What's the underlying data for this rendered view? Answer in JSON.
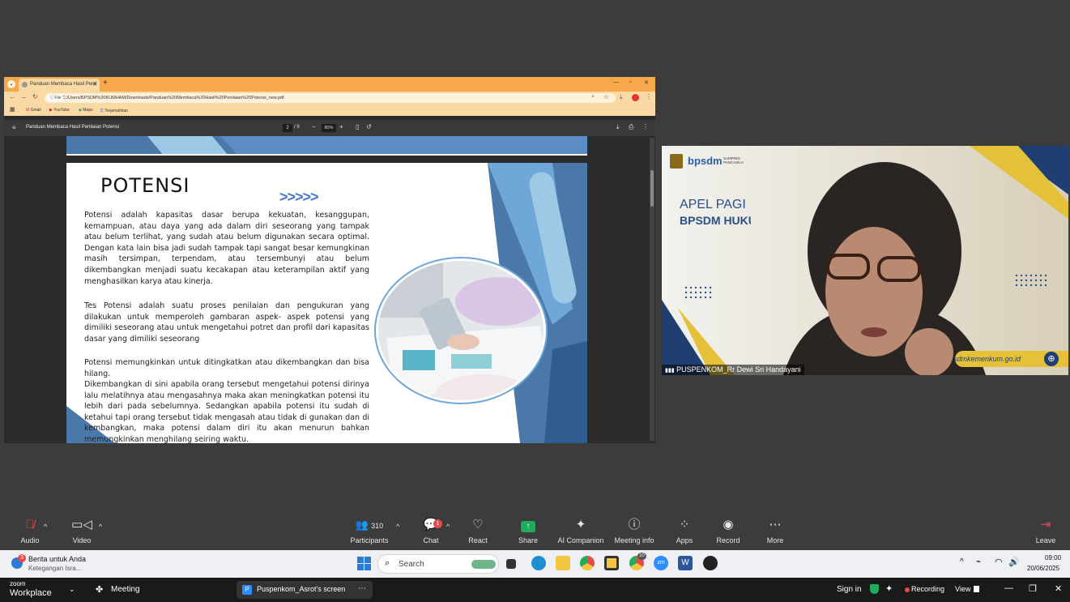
{
  "browser": {
    "tab_title": "Panduan Membaca Hasil Penil",
    "address": "C:/Users/BPSDM%20KUMHAM/Downloads/Panduan%20Membaca%20Hasil%20Penilaian%20Potensi_new.pdf",
    "file_chip": "File",
    "bookmarks": [
      "Gmail",
      "YouTube",
      "Maps",
      "Terjemahkan"
    ]
  },
  "pdf": {
    "title": "Panduan Membaca Hasil Penilaian Potensi",
    "page_current": "2",
    "page_total": "/ 9",
    "zoom": "80%",
    "page": {
      "heading": "POTENSI",
      "chevrons": ">>>>>",
      "para1": "Potensi adalah kapasitas dasar berupa kekuatan, kesanggupan, kemampuan, atau daya yang ada dalam diri seseorang yang tampak atau belum terlihat, yang sudah atau belum digunakan secara optimal. Dengan kata lain bisa jadi sudah tampak tapi sangat besar kemungkinan masih tersimpan, terpendam, atau tersembunyi atau belum dikembangkan menjadi suatu kecakapan atau keterampilan aktif yang menghasilkan karya atau kinerja.",
      "para2": "Tes Potensi adalah suatu proses penilaian dan pengukuran yang dilakukan untuk memperoleh gambaran aspek- aspek potensi yang dimiliki seseorang atau untuk mengetahui potret dan profil dari kapasitas dasar yang dimiliki seseorang",
      "para3": "Potensi memungkinkan untuk ditingkatkan atau dikembangkan dan bisa hilang.",
      "para4": "Dikembangkan di sini apabila orang tersebut  mengetahui potensi dirinya lalu melatihnya atau mengasahnya maka akan meningkatkan  potensi itu lebih dari pada sebelumnya. Sedangkan apabila potensi itu sudah di ketahui tapi orang tersebut tidak mengasah atau  tidak di gunakan dan di kembangkan, maka potensi dalam diri itu akan menurun bahkan memungkinkan menghilang seiring waktu."
    }
  },
  "video": {
    "logo_text": "bpsdm",
    "logo_sub": "SAMPING PANCASILA",
    "banner_line1": "APEL PAGI",
    "banner_line2": "BPSDM HUKUM",
    "website": "bpsdmkemenkum.go.id",
    "participant_name": "PUSPENKOM_Rr Dewi Sri Handayani"
  },
  "toolbar": {
    "audio": "Audio",
    "video": "Video",
    "participants": "Participants",
    "participant_count": "310",
    "chat": "Chat",
    "chat_badge": "1",
    "react": "React",
    "share": "Share",
    "ai": "AI Companion",
    "meeting_info": "Meeting info",
    "apps": "Apps",
    "record": "Record",
    "more": "More",
    "leave": "Leave"
  },
  "taskbar": {
    "news_title": "Berita untuk Anda",
    "news_sub": "Ketegangan Isra...",
    "news_badge": "3",
    "search": "Search",
    "time": "09:00",
    "date": "20/06/2025",
    "chrome_badge": "10"
  },
  "workplace": {
    "logo_top": "zoom",
    "logo_bottom": "Workplace",
    "meeting": "Meeting",
    "screen_tab": "Puspenkom_Asrot's screen",
    "screen_initial": "P",
    "sign_in": "Sign in",
    "recording": "Recording",
    "view": "View"
  },
  "colors": {
    "accent_blue": "#3a7bd5",
    "zoom_green": "#1fad5b",
    "chrome_orange": "#f7a84a"
  }
}
